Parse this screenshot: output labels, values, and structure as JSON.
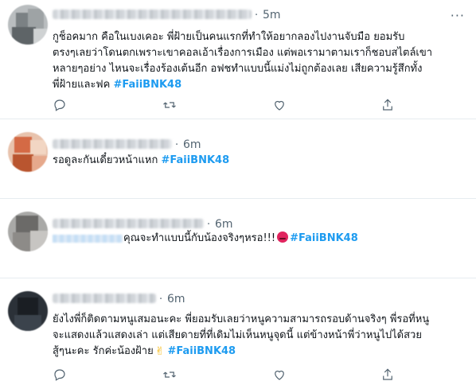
{
  "tweets": [
    {
      "time": "5m",
      "separator": "·",
      "more": "···",
      "text_lines": [
        "กูช็อคมาก คือในเบงเคอะ พี่ฝ้ายเป็นคนแรกที่ทำให้อยากลองไปงานจับมือ ยอมรับ",
        "ตรงๆเลยว่าโดนตกเพราะเขาคอลเอ้าเรื่องการเมือง แต่พอเรามาตามเราก็ชอบสไตล์เขา",
        "หลายๆอย่าง ไหนจะเรื่องร้องเต้นอีก อฟชทำแบบนี้แม่งไม่ถูกต้องเลย เสียความรู้สึกทั้ง",
        "พี่ฝ้ายและฟค"
      ],
      "hashtag": "#FaiiBNK48"
    },
    {
      "time": "6m",
      "separator": "·",
      "text": "รอดูละกันเดี๋ยวหน้าแหก",
      "hashtag": "#FaiiBNK48"
    },
    {
      "time": "6m",
      "separator": "·",
      "text": "คุณจะทำแบบนี้กับน้องจริงๆหรอ!!!",
      "emoji": "angry-face",
      "hashtag": "#FaiiBNK48"
    },
    {
      "time": "6m",
      "separator": "·",
      "text_lines": [
        "ยังไงพี่ก็ติดตามหนูเสมอนะคะ พี่ยอมรับเลยว่าหนูความสามารถรอบด้านจริงๆ พี่รอที่หนู",
        "จะแสดงแล้วแสดงเล่า แต่เสียดายที่ที่เดิมไม่เห็นหนูจุดนี้ แต่ข้างหน้าพี่ว่าหนูไปได้สวย",
        "สู้ๆนะคะ รักค่ะน้องฝ้าย"
      ],
      "emoji": "victory-hand",
      "emoji_glyph": "✌",
      "hashtag": "#FaiiBNK48"
    }
  ],
  "colors": {
    "accent": "#1d9bf0",
    "text": "#0f1419",
    "muted": "#536471",
    "divider": "#e6ecf0"
  },
  "icons": [
    "reply-icon",
    "retweet-icon",
    "like-icon",
    "share-icon",
    "more-options-icon"
  ]
}
